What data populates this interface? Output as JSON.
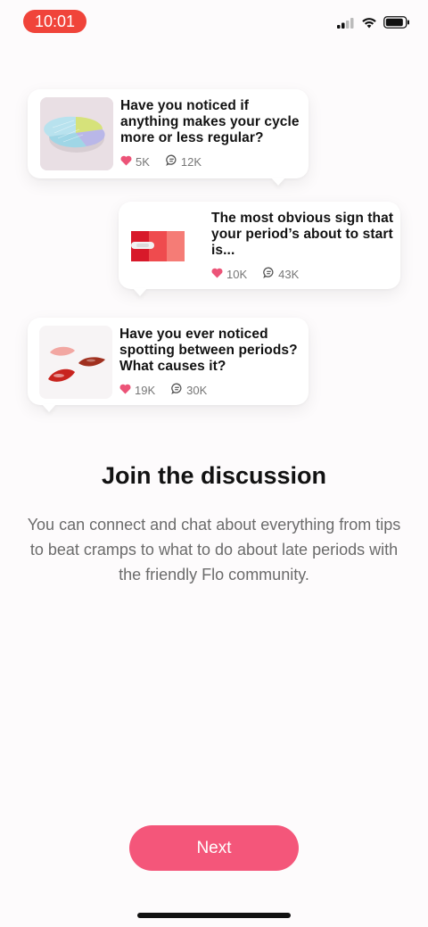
{
  "status_bar": {
    "time": "10:01",
    "accent": "#f0443a"
  },
  "cards": [
    {
      "question": "Have you noticed if anything makes your cycle more or less regular?",
      "likes": "5K",
      "comments": "12K"
    },
    {
      "question": "The most obvious sign that your period’s about to start is...",
      "likes": "10K",
      "comments": "43K"
    },
    {
      "question": "Have you ever noticed spotting between periods? What causes it?",
      "likes": "19K",
      "comments": "30K"
    }
  ],
  "headline": "Join the discussion",
  "description": "You can connect and chat about everything from tips to beat cramps to what to do about late periods with the friendly Flo community.",
  "next_button": {
    "label": "Next",
    "color": "#f4567a"
  },
  "icons": {
    "like": "heart-icon",
    "comment": "comment-bubble-icon"
  }
}
